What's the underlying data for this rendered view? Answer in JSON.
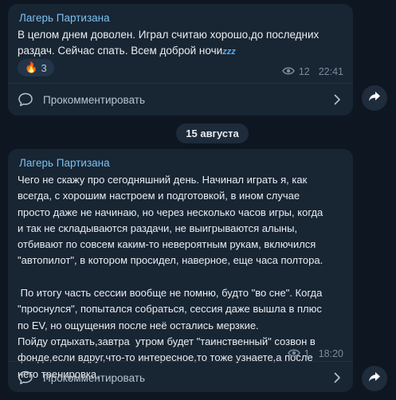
{
  "posts": [
    {
      "author": "Лагерь Партизана",
      "text": "В целом днем доволен. Играл считаю хорошо,до последних\nраздач. Сейчас спать. Всем доброй ночи",
      "text_emoji": "zzz",
      "reaction": {
        "emoji": "🔥",
        "count": "3"
      },
      "views": "12",
      "time": "22:41",
      "comment_label": "Прокомментировать"
    },
    {
      "author": "Лагерь Партизана",
      "text": "Чего не скажу про сегодняшний день. Начинал играть я, как\nвсегда, с хорошим настроем и подготовкой, в ином случае\nпросто даже не начинаю, но через несколько часов игры, когда\nи так не складываются раздачи, не выигрываются алыны,\nотбивают по совсем каким-то невероятным рукам, включился\n\"автопилот\", в котором просидел, наверное, еще часа полтора.\n\n По итогу часть сессии вообще не помню, будто \"во сне\". Когда\n\"проснулся\", попытался собраться, сессия даже вышла в плюс\nпо EV, но ощущения после неё остались мерзкие.\nПойду отдыхать,завтра  утром будет \"таинственный\" созвон в\nфонде,если вдруг,что-то интересное,то тоже узнаете,а после\nнего тренировка.",
      "views": "1",
      "time": "18:20",
      "comment_label": "Прокомментировать"
    }
  ],
  "date_separator": "15 августа",
  "colors": {
    "background": "#0e1621",
    "bubble": "#182533",
    "author": "#7cc0f2",
    "meta": "#7c8b9a"
  },
  "icons": [
    "views-eye-icon",
    "comment-icon",
    "chevron-right-icon",
    "share-arrow-icon"
  ]
}
